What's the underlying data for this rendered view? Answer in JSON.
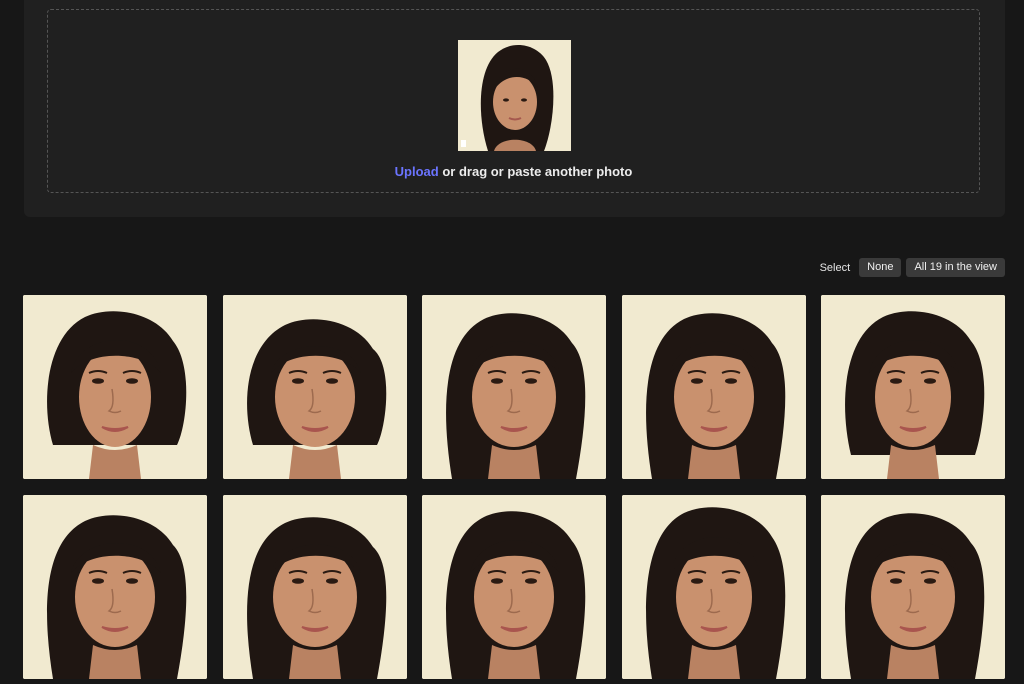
{
  "upload": {
    "link_label": "Upload",
    "rest_label": " or drag or paste another photo",
    "preview_icon": "uploaded-face-thumbnail"
  },
  "selection": {
    "label": "Select",
    "none_button": "None",
    "all_button": "All 19 in the view"
  },
  "colors": {
    "page_bg": "#171717",
    "panel_bg": "#202020",
    "link": "#6b74ff",
    "button_bg": "#3a3a3a",
    "photo_bg": "#f1ead0",
    "hair": "#1f1612",
    "skin": "#c9916e"
  },
  "photos": [
    {
      "id": "face-1"
    },
    {
      "id": "face-2"
    },
    {
      "id": "face-3"
    },
    {
      "id": "face-4"
    },
    {
      "id": "face-5"
    },
    {
      "id": "face-6"
    },
    {
      "id": "face-7"
    },
    {
      "id": "face-8"
    },
    {
      "id": "face-9"
    },
    {
      "id": "face-10"
    }
  ]
}
